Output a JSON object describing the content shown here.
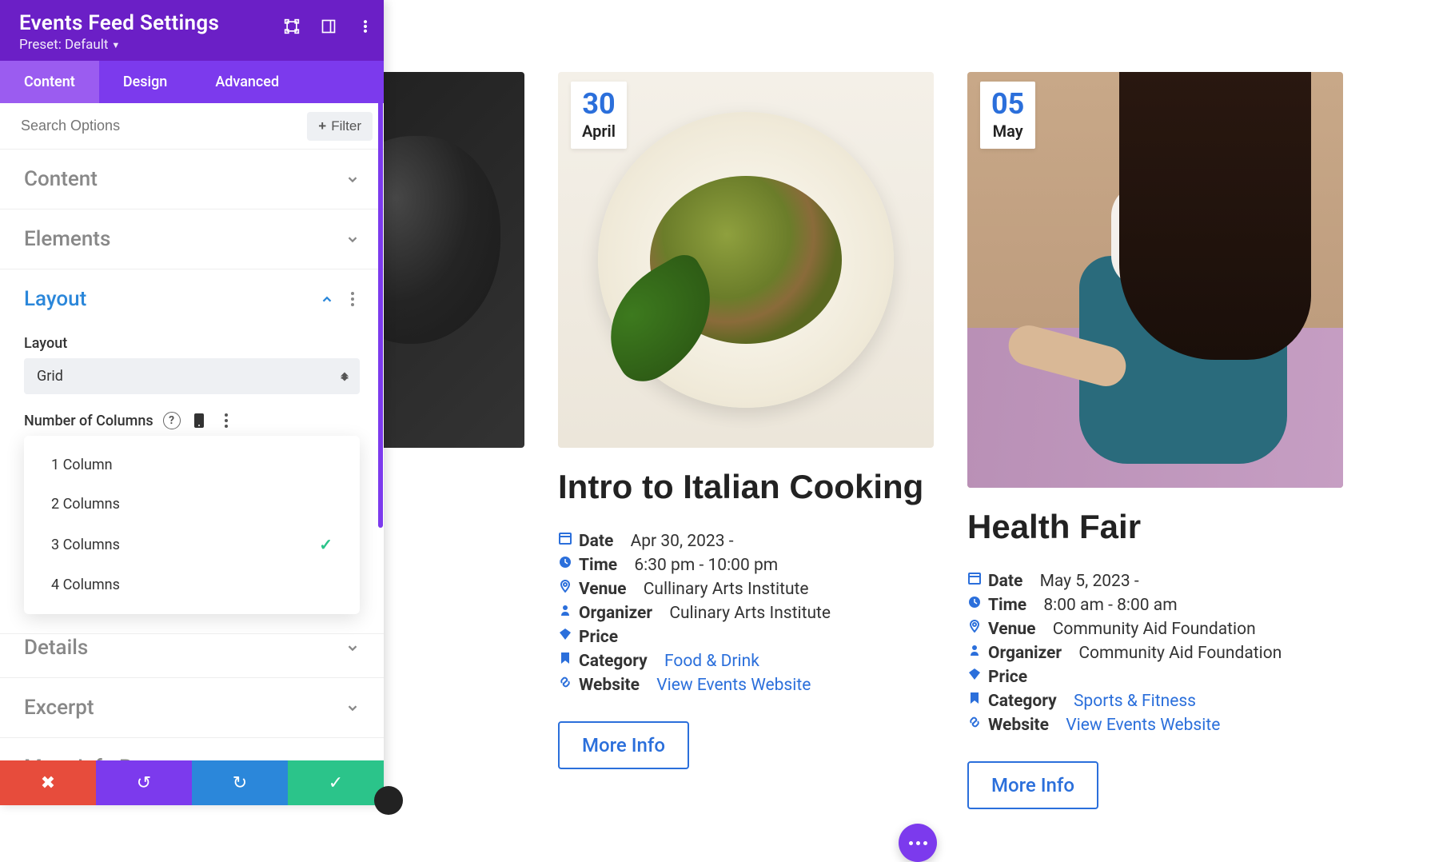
{
  "panel": {
    "title": "Events Feed Settings",
    "preset_label": "Preset: Default",
    "tabs": {
      "content": "Content",
      "design": "Design",
      "advanced": "Advanced"
    },
    "search_placeholder": "Search Options",
    "filter_label": "Filter",
    "sections": {
      "content": "Content",
      "elements": "Elements",
      "layout": "Layout",
      "details": "Details",
      "excerpt": "Excerpt",
      "more_info_button": "More Info Button"
    },
    "layout_field_label": "Layout",
    "layout_value": "Grid",
    "columns_label": "Number of Columns",
    "column_options": [
      "1 Column",
      "2 Columns",
      "3 Columns",
      "4 Columns"
    ],
    "column_selected_index": 2
  },
  "events": [
    {
      "day": "30",
      "month": "April",
      "title": "Intro to Italian Cooking",
      "date": "Apr 30, 2023 -",
      "time": "6:30 pm - 10:00 pm",
      "venue": "Cullinary Arts Institute",
      "organizer": "Culinary Arts Institute",
      "price": "",
      "category": "Food & Drink",
      "website": "View Events Website",
      "more": "More Info"
    },
    {
      "day": "05",
      "month": "May",
      "title": "Health Fair",
      "date": "May 5, 2023 -",
      "time": "8:00 am - 8:00 am",
      "venue": "Community Aid Foundation",
      "organizer": "Community Aid Foundation",
      "price": "",
      "category": "Sports & Fitness",
      "website": "View Events Website",
      "more": "More Info"
    }
  ],
  "labels": {
    "date": "Date",
    "time": "Time",
    "venue": "Venue",
    "organizer": "Organizer",
    "price": "Price",
    "category": "Category",
    "website": "Website"
  }
}
